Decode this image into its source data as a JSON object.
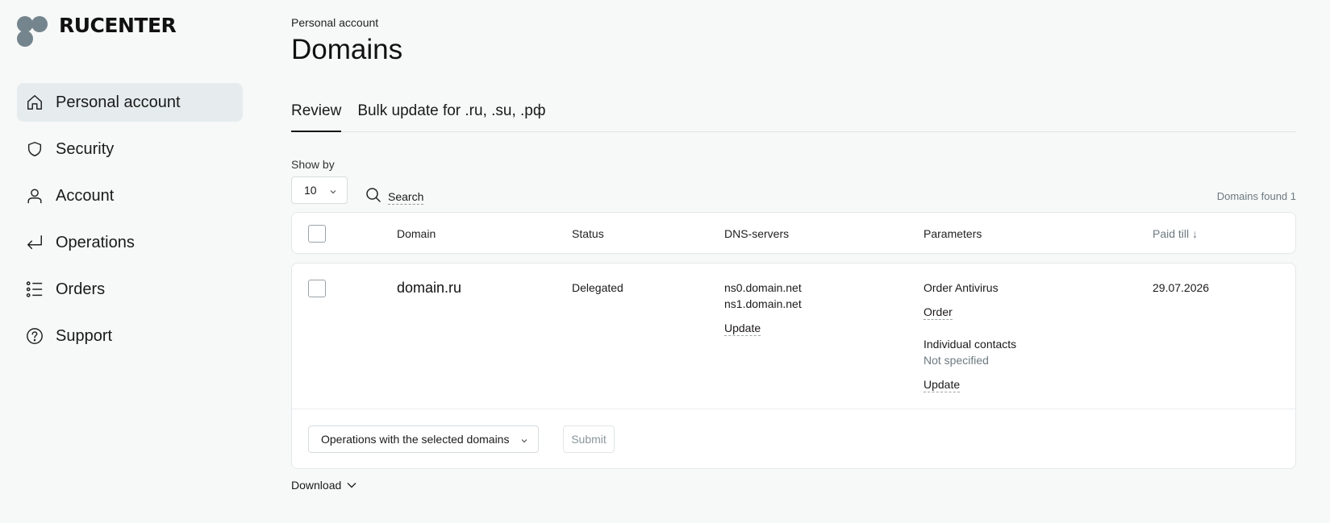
{
  "brand": {
    "name": "RUCENTER",
    "dot_color": "#75858d"
  },
  "sidebar": {
    "items": [
      {
        "label": "Personal account",
        "icon": "home-icon",
        "active": true
      },
      {
        "label": "Security",
        "icon": "shield-icon"
      },
      {
        "label": "Account",
        "icon": "user-icon"
      },
      {
        "label": "Operations",
        "icon": "enter-arrow-icon"
      },
      {
        "label": "Orders",
        "icon": "list-icon"
      },
      {
        "label": "Support",
        "icon": "help-circle-icon"
      }
    ]
  },
  "header": {
    "breadcrumb": "Personal account",
    "title": "Domains"
  },
  "tabs": [
    {
      "label": "Review",
      "active": true
    },
    {
      "label": "Bulk update for .ru, .su, .рф"
    }
  ],
  "toolbar": {
    "show_by_label": "Show by",
    "show_by_value": "10",
    "search_label": "Search",
    "domains_found": "Domains found 1"
  },
  "table": {
    "columns": [
      "Domain",
      "Status",
      "DNS-servers",
      "Parameters",
      "Paid till ↓"
    ],
    "rows": [
      {
        "domain": "domain.ru",
        "status": "Delegated",
        "dns": [
          "ns0.domain.net",
          "ns1.domain.net"
        ],
        "dns_update": "Update",
        "antivirus_label": "Order Antivirus",
        "antivirus_link": "Order",
        "contacts_label": "Individual contacts",
        "contacts_value": "Not specified",
        "contacts_update": "Update",
        "paid_till": "29.07.2026"
      }
    ]
  },
  "footer": {
    "operations_placeholder": "Operations with the selected domains",
    "submit_label": "Submit",
    "download_label": "Download"
  }
}
